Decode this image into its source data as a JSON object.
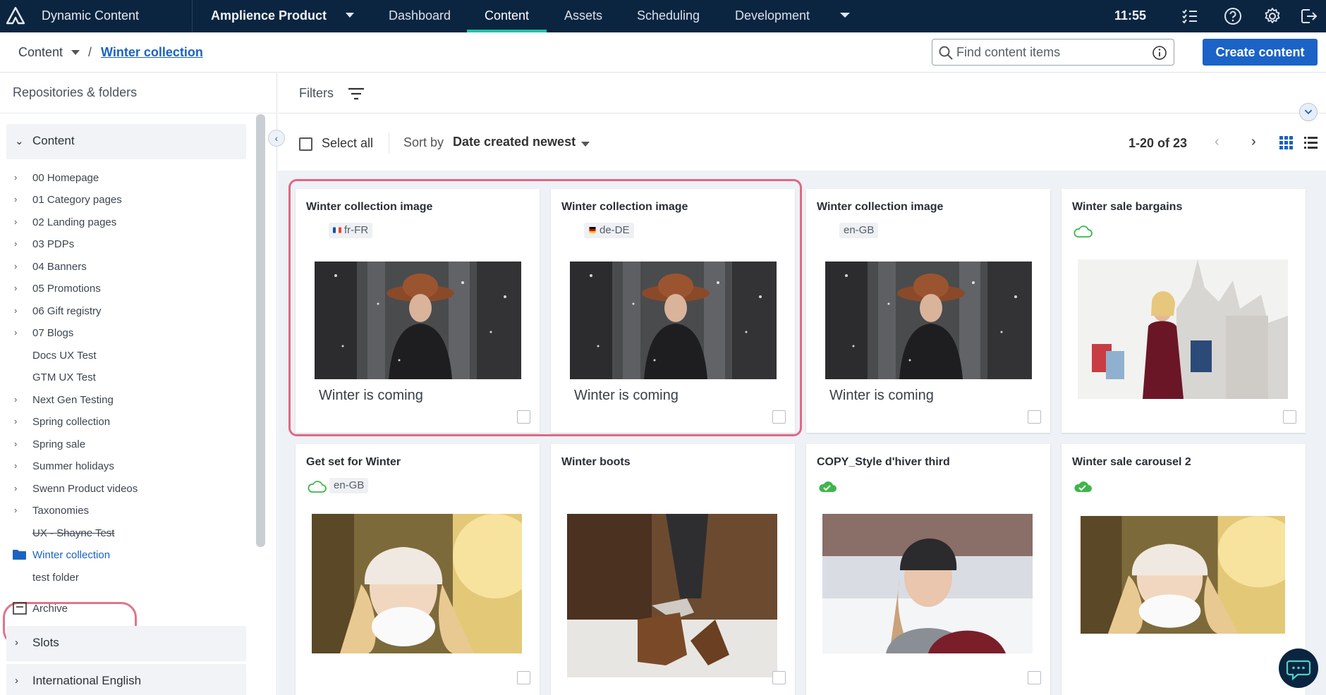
{
  "topnav": {
    "brand": "Dynamic Content",
    "product": "Amplience Product",
    "tabs": [
      {
        "label": "Dashboard",
        "active": false
      },
      {
        "label": "Content",
        "active": true
      },
      {
        "label": "Assets",
        "active": false
      },
      {
        "label": "Scheduling",
        "active": false
      },
      {
        "label": "Development",
        "active": false
      }
    ],
    "time": "11:55",
    "icons": [
      "tasks-icon",
      "help-icon",
      "settings-icon",
      "logout-icon"
    ],
    "accent_color": "#22c1a8",
    "bg_color": "#0b2541"
  },
  "breadcrumb": {
    "root": "Content",
    "separator": "/",
    "current": "Winter collection"
  },
  "search": {
    "placeholder": "Find content items",
    "value": ""
  },
  "create_button": "Create content",
  "sidebar": {
    "title": "Repositories & folders",
    "content_section": "Content",
    "items": [
      {
        "label": "00 Homepage",
        "expandable": true
      },
      {
        "label": "01 Category pages",
        "expandable": true
      },
      {
        "label": "02 Landing pages",
        "expandable": true
      },
      {
        "label": "03 PDPs",
        "expandable": true
      },
      {
        "label": "04 Banners",
        "expandable": true
      },
      {
        "label": "05 Promotions",
        "expandable": true
      },
      {
        "label": "06 Gift registry",
        "expandable": true
      },
      {
        "label": "07 Blogs",
        "expandable": true
      },
      {
        "label": "Docs UX Test",
        "expandable": false
      },
      {
        "label": "GTM UX Test",
        "expandable": false
      },
      {
        "label": "Next Gen Testing",
        "expandable": true
      },
      {
        "label": "Spring collection",
        "expandable": true
      },
      {
        "label": "Spring sale",
        "expandable": true
      },
      {
        "label": "Summer holidays",
        "expandable": true
      },
      {
        "label": "Swenn Product videos",
        "expandable": true
      },
      {
        "label": "Taxonomies",
        "expandable": true
      },
      {
        "label": "UX - Shayne Test",
        "expandable": false
      },
      {
        "label": "Winter collection",
        "expandable": false,
        "active": true
      },
      {
        "label": "test folder",
        "expandable": false
      }
    ],
    "archive": "Archive",
    "slots_section": "Slots",
    "intl_section": "International English"
  },
  "filters": {
    "label": "Filters"
  },
  "toolbar": {
    "select_all": "Select all",
    "sort_label": "Sort by",
    "sort_value": "Date created newest",
    "pagination": "1-20 of 23"
  },
  "cards": [
    {
      "title": "Winter collection image",
      "locale": "fr-FR",
      "flag": "fr",
      "caption": "Winter is coming",
      "image": "woman-hat-snow",
      "status": "none"
    },
    {
      "title": "Winter collection image",
      "locale": "de-DE",
      "flag": "de",
      "caption": "Winter is coming",
      "image": "woman-hat-snow",
      "status": "none"
    },
    {
      "title": "Winter collection image",
      "locale": "en-GB",
      "flag": "",
      "caption": "Winter is coming",
      "image": "woman-hat-snow",
      "status": "none"
    },
    {
      "title": "Winter sale bargains",
      "locale": "",
      "flag": "",
      "caption": "",
      "image": "shopping-woman",
      "status": "cloud-outline"
    },
    {
      "title": "Get set for Winter",
      "locale": "en-GB",
      "flag": "",
      "caption": "",
      "image": "woman-knit-hat",
      "status": "cloud-outline"
    },
    {
      "title": "Winter boots",
      "locale": "",
      "flag": "",
      "caption": "",
      "image": "boots",
      "status": "none"
    },
    {
      "title": "COPY_Style d'hiver third",
      "locale": "",
      "flag": "",
      "caption": "",
      "image": "woman-beanie",
      "status": "cloud-published"
    },
    {
      "title": "Winter sale carousel 2",
      "locale": "",
      "flag": "",
      "caption": "",
      "image": "woman-knit-hat",
      "status": "cloud-published"
    }
  ]
}
